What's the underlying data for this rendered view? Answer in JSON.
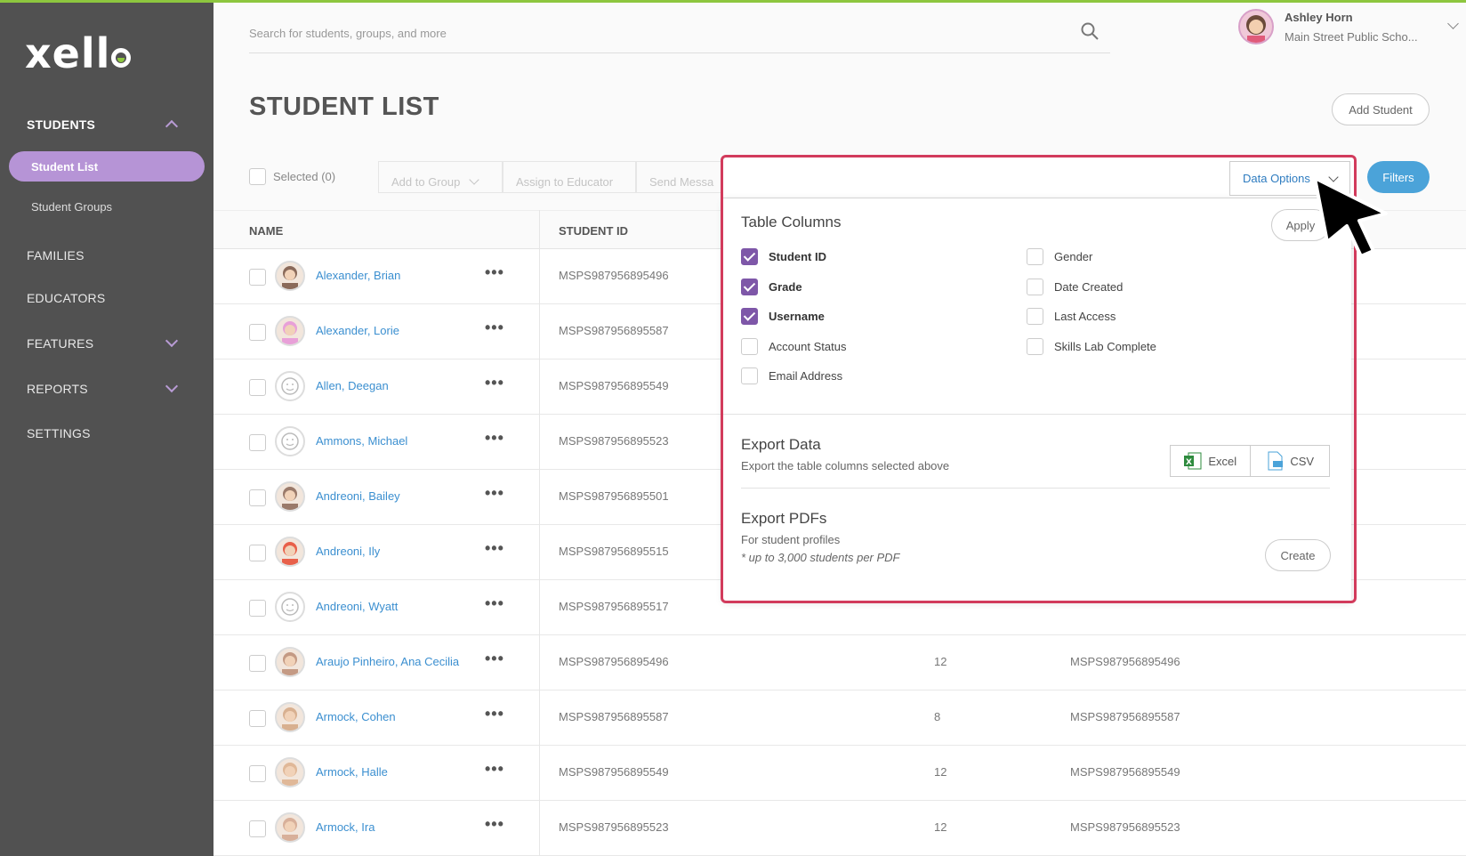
{
  "brand": {
    "logo_text": "xell",
    "accent": "#8dc63f"
  },
  "sidebar": {
    "students": "STUDENTS",
    "student_list": "Student List",
    "student_groups": "Student Groups",
    "families": "FAMILIES",
    "educators": "EDUCATORS",
    "features": "FEATURES",
    "reports": "REPORTS",
    "settings": "SETTINGS"
  },
  "search": {
    "placeholder": "Search for students, groups, and more",
    "icon": "search-icon"
  },
  "user": {
    "name": "Ashley Horn",
    "school": "Main Street Public Scho..."
  },
  "page": {
    "title": "STUDENT LIST",
    "add_student": "Add Student",
    "filters": "Filters"
  },
  "toolbar": {
    "selected": "Selected (0)",
    "add_to_group": "Add to Group",
    "assign_to_educator": "Assign to Educator",
    "send_message": "Send Messa"
  },
  "table": {
    "headers": {
      "name": "NAME",
      "student_id": "STUDENT ID"
    },
    "rows": [
      {
        "name": "Alexander, Brian",
        "student_id": "MSPS987956895496",
        "grade": "",
        "username": ""
      },
      {
        "name": "Alexander, Lorie",
        "student_id": "MSPS987956895587",
        "grade": "",
        "username": ""
      },
      {
        "name": "Allen, Deegan",
        "student_id": "MSPS987956895549",
        "grade": "",
        "username": ""
      },
      {
        "name": "Ammons, Michael",
        "student_id": "MSPS987956895523",
        "grade": "",
        "username": ""
      },
      {
        "name": "Andreoni, Bailey",
        "student_id": "MSPS987956895501",
        "grade": "",
        "username": ""
      },
      {
        "name": "Andreoni, Ily",
        "student_id": "MSPS987956895515",
        "grade": "",
        "username": ""
      },
      {
        "name": "Andreoni, Wyatt",
        "student_id": "MSPS987956895517",
        "grade": "",
        "username": ""
      },
      {
        "name": "Araujo Pinheiro, Ana Cecilia",
        "student_id": "MSPS987956895496",
        "grade": "12",
        "username": "MSPS987956895496"
      },
      {
        "name": "Armock, Cohen",
        "student_id": "MSPS987956895587",
        "grade": "8",
        "username": "MSPS987956895587"
      },
      {
        "name": "Armock, Halle",
        "student_id": "MSPS987956895549",
        "grade": "12",
        "username": "MSPS987956895549"
      },
      {
        "name": "Armock, Ira",
        "student_id": "MSPS987956895523",
        "grade": "12",
        "username": "MSPS987956895523"
      }
    ],
    "more_label": "•••"
  },
  "data_options": {
    "button": "Data Options",
    "table_columns_title": "Table Columns",
    "apply": "Apply",
    "columns_left": [
      {
        "label": "Student ID",
        "checked": true
      },
      {
        "label": "Grade",
        "checked": true
      },
      {
        "label": "Username",
        "checked": true
      },
      {
        "label": "Account Status",
        "checked": false
      },
      {
        "label": "Email Address",
        "checked": false
      }
    ],
    "columns_right": [
      {
        "label": "Gender",
        "checked": false
      },
      {
        "label": "Date Created",
        "checked": false
      },
      {
        "label": "Last Access",
        "checked": false
      },
      {
        "label": "Skills Lab Complete",
        "checked": false
      }
    ],
    "export_data_title": "Export Data",
    "export_data_sub": "Export the table columns selected above",
    "excel": "Excel",
    "csv": "CSV",
    "export_pdfs_title": "Export PDFs",
    "export_pdfs_sub": "For student profiles",
    "export_pdfs_note": "* up to 3,000 students per PDF",
    "create": "Create"
  },
  "colors": {
    "highlight": "#d23b5c",
    "primary_blue": "#4ba3d9",
    "purple": "#7e57a8",
    "sidebar": "#515151"
  }
}
